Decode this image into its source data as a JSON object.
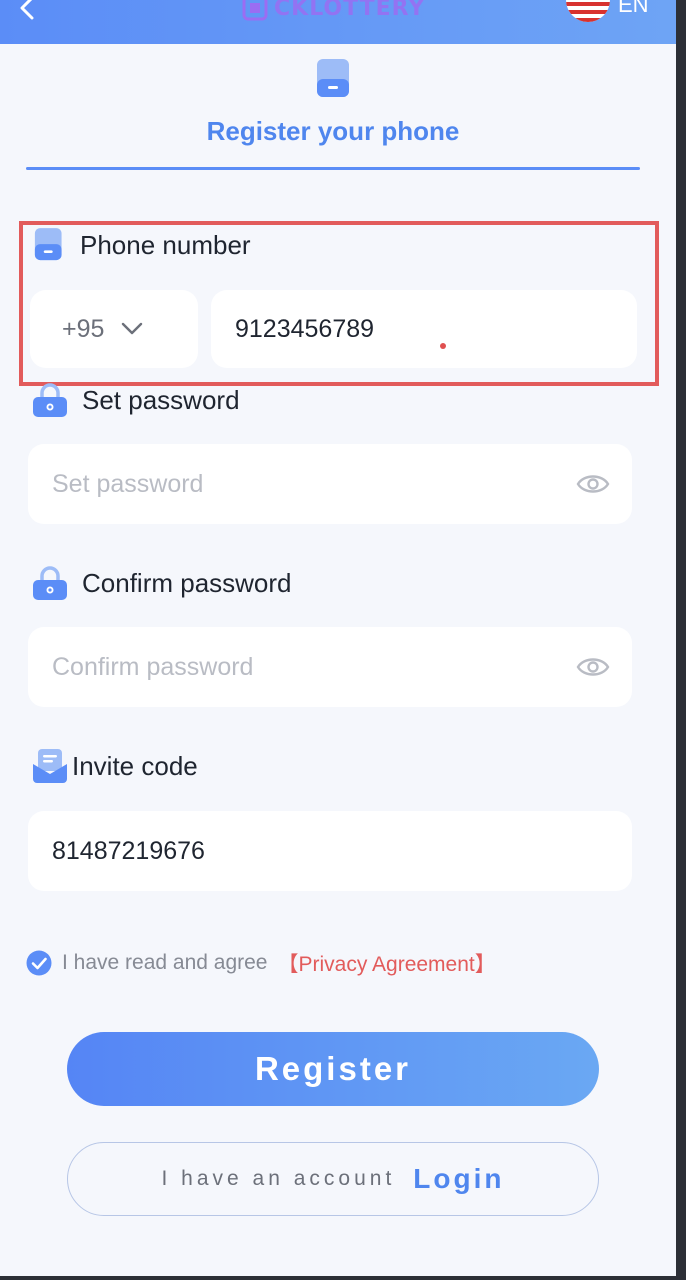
{
  "header": {
    "logo_text": "CKLOTTERY",
    "language": "EN"
  },
  "tab": {
    "title": "Register your phone"
  },
  "phone": {
    "label": "Phone number",
    "country_code": "+95",
    "value": "9123456789"
  },
  "password": {
    "label": "Set password",
    "placeholder": "Set password"
  },
  "confirm": {
    "label": "Confirm password",
    "placeholder": "Confirm password"
  },
  "invite": {
    "label": "Invite code",
    "value": "81487219676"
  },
  "agreement": {
    "text": "I have read and agree",
    "link": "【Privacy Agreement】",
    "checked": true
  },
  "actions": {
    "register_label": "Register",
    "have_account": "I have an account",
    "login_label": "Login"
  },
  "colors": {
    "accent": "#5b8df7",
    "highlight": "#e25b5b",
    "background": "#f5f7fc"
  },
  "icons": [
    "back-icon",
    "logo-mark-icon",
    "us-flag-icon",
    "phone-icon",
    "lock-icon",
    "eye-icon",
    "invite-icon",
    "check-icon",
    "chevron-down-icon"
  ]
}
